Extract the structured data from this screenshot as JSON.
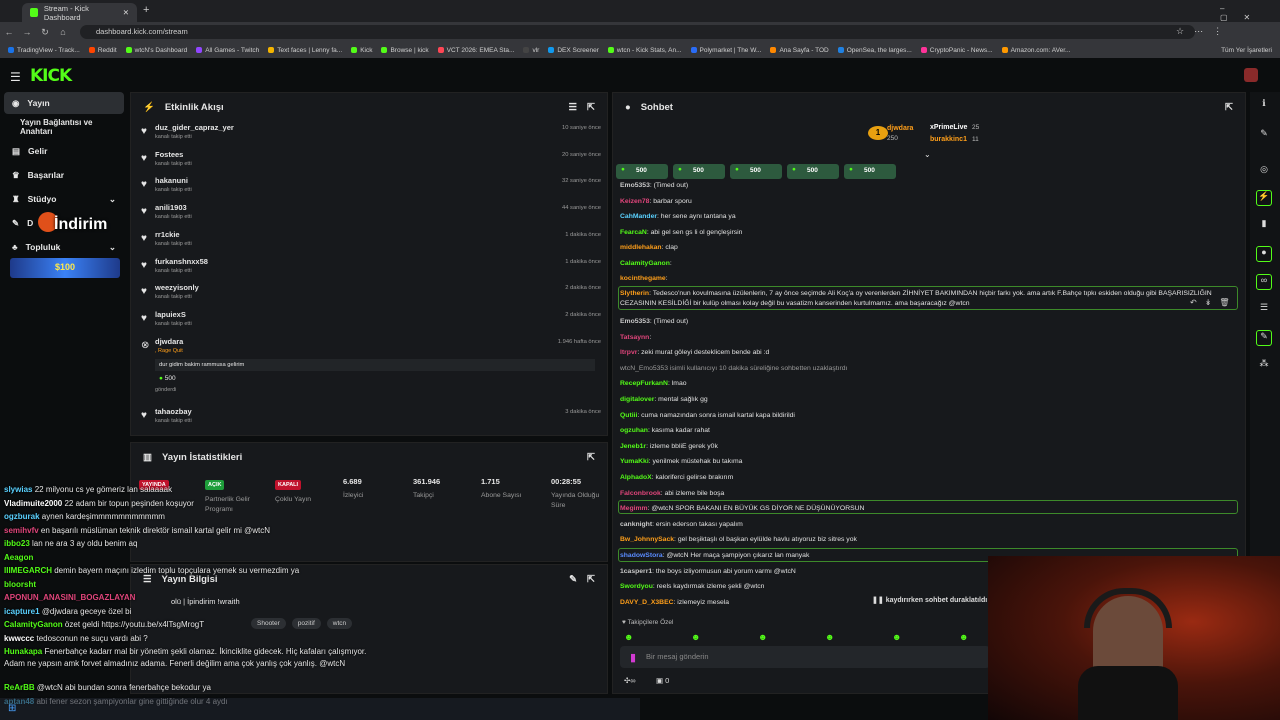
{
  "browser": {
    "tabs": [
      {
        "title": "Stream - Kick Dashboard"
      }
    ],
    "url": "dashboard.kick.com/stream",
    "bookmarks": [
      "TradingView - Track...",
      "Reddit",
      "wtcN's Dashboard",
      "All Games - Twitch",
      "Text faces | Lenny fa...",
      "Kick",
      "Browse | kick",
      "VCT 2026: EMEA Sta...",
      "vlr",
      "DEX Screener",
      "wtcn - Kick Stats, An...",
      "Polymarket | The W...",
      "Ana Sayfa - TOD",
      "OpenSea, the larges...",
      "CryptoPanic - News...",
      "Amazon.com: AVer..."
    ],
    "all_bookmarks": "Tüm Yer İşaretleri"
  },
  "sidebar": {
    "items": [
      {
        "label": "Yayın",
        "icon": "broadcast-icon"
      },
      {
        "label": "Yayın Bağlantısı ve Anahtarı",
        "icon": ""
      },
      {
        "label": "Gelir",
        "icon": "money-icon"
      },
      {
        "label": "Başarılar",
        "icon": "trophy-icon"
      },
      {
        "label": "Stüdyo",
        "icon": "studio-icon"
      },
      {
        "label": "D",
        "icon": "tool-icon"
      },
      {
        "label": "Topluluk",
        "icon": "people-icon"
      }
    ],
    "overlay_text": "İndirim",
    "promo": "$100"
  },
  "activity": {
    "title": "Etkinlik Akışı",
    "items": [
      {
        "name": "duz_gider_capraz_yer",
        "sub": "kanalı takip etti",
        "time": "10 saniye önce"
      },
      {
        "name": "Fostees",
        "sub": "kanalı takip etti",
        "time": "20 saniye önce"
      },
      {
        "name": "hakanuni",
        "sub": "kanalı takip etti",
        "time": "32 saniye önce"
      },
      {
        "name": "anili1903",
        "sub": "kanalı takip etti",
        "time": "44 saniye önce"
      },
      {
        "name": "rr1ckie",
        "sub": "kanalı takip etti",
        "time": "1 dakika önce"
      },
      {
        "name": "furkanshnxx58",
        "sub": "kanalı takip etti",
        "time": "1 dakika önce"
      },
      {
        "name": "weezyisonly",
        "sub": "kanalı takip etti",
        "time": "2 dakika önce"
      },
      {
        "name": "lapuiexS",
        "sub": "kanalı takip etti",
        "time": "2 dakika önce"
      },
      {
        "name": "djwdara",
        "sub": ", Rage Quit",
        "time": "1.946 hafta önce",
        "message": "dur gidim bakim rammusa gelirim",
        "amount": "500",
        "sent": "gönderdi"
      },
      {
        "name": "tahaozbay",
        "sub": "kanalı takip etti",
        "time": "3 dakika önce"
      }
    ]
  },
  "stats": {
    "title": "Yayın İstatistikleri",
    "items": [
      {
        "badge": "YAYINDA",
        "label": ""
      },
      {
        "badge": "AÇIK",
        "label": "Partnerlik Gelir Programı"
      },
      {
        "badge": "KAPALI",
        "label": "Çoklu Yayın"
      },
      {
        "value": "6.689",
        "label": "İzleyici"
      },
      {
        "value": "361.946",
        "label": "Takipçi"
      },
      {
        "value": "1.715",
        "label": "Abone Sayısı"
      },
      {
        "value": "00:28:55",
        "label": "Yayında Olduğu Süre"
      }
    ]
  },
  "stream_info": {
    "title": "Yayın Bilgisi",
    "line1": "olü | İpindirim !wraith",
    "tags": [
      "Shooter",
      "pozitif",
      "wtcn"
    ]
  },
  "chat": {
    "title": "Sohbet",
    "leaderboard": [
      {
        "rank": "1",
        "name": "djwdara",
        "value": "250"
      },
      {
        "rank": "",
        "name": "xPrimeLive",
        "value": "25"
      },
      {
        "rank": "",
        "name": "burakkinc1",
        "value": "11"
      }
    ],
    "gifts": [
      "500",
      "500",
      "500",
      "500",
      "500"
    ],
    "messages": [
      {
        "user": "Emo5353",
        "text": "(Timed out)",
        "color": "#c9c9c9"
      },
      {
        "user": "Keizen78",
        "text": "barbar sporu",
        "color": "#e0457b"
      },
      {
        "user": "CahMander",
        "text": "her sene aynı tantana ya",
        "color": "#5ad1ff"
      },
      {
        "user": "FearcaN",
        "text": "abi gel sen gs li ol gençleşirsin",
        "color": "#53fc18"
      },
      {
        "user": "middlehakan",
        "text": "clap",
        "color": "#ff9f1a"
      },
      {
        "user": "CalamityGanon",
        "text": "",
        "color": "#53fc18"
      },
      {
        "user": "kocinthegame",
        "text": "",
        "color": "#ff9f1a"
      },
      {
        "user": "Slytherin",
        "text": "Tedesco'nun kovulmasına üzülenlerin, 7 ay önce seçimde Ali Koç'a oy verenlerden ZİHNİYET BAKIMINDAN hiçbir farkı yok. ama artık F.Bahçe tıpkı eskiden olduğu gibi BAŞARISIZLIĞIN CEZASININ KESİLDİĞİ bir kulüp olması kolay değil bu vasatizm kanserinden kurtulmamız. ama başaracağız @wtcn",
        "color": "#ff9f1a"
      },
      {
        "user": "Emo5353",
        "text": "(Timed out)",
        "color": "#c9c9c9"
      },
      {
        "user": "Tatsaynn",
        "text": "",
        "color": "#e0457b"
      },
      {
        "user": "ltrpvr",
        "text": "zeki murat göleyi desteklicem bende abi :d",
        "color": "#e0457b"
      },
      {
        "user": "",
        "text": "wtcN_Emo5353 isimli kullanıcıyı 10 dakika süreliğine sohbetten uzaklaştırdı",
        "color": "#9a9a9a"
      },
      {
        "user": "RecepFurkanN",
        "text": "lmao",
        "color": "#53fc18"
      },
      {
        "user": "digitalover",
        "text": "mental sağlık gg",
        "color": "#53fc18"
      },
      {
        "user": "Qutiii",
        "text": "cuma namazından sonra ismail kartal kapa bildirildi",
        "color": "#53fc18"
      },
      {
        "user": "ogzuhan",
        "text": "kasıma kadar rahat",
        "color": "#53fc18"
      },
      {
        "user": "Jeneb1r",
        "text": "izleme bbliE gerek y0k",
        "color": "#53fc18"
      },
      {
        "user": "YumaKki",
        "text": "yenilmek müstehak bu takıma",
        "color": "#53fc18"
      },
      {
        "user": "AlphadoX",
        "text": "kaloriferci gelirse brakırım",
        "color": "#53fc18"
      },
      {
        "user": "Falconbrook",
        "text": "abi izleme bile boşa",
        "color": "#e0457b"
      },
      {
        "user": "Megimm",
        "text": "@wtcN SPOR BAKANI EN BÜYÜK GS DİYOR NE DÜŞÜNÜYORSUN",
        "color": "#e0457b"
      },
      {
        "user": "canknight",
        "text": "ersin ederson takası yapalım",
        "color": "#c9c9c9"
      },
      {
        "user": "Bw_JohnnySack",
        "text": "gel beşiktaşlı ol başkan eylülde havlu atıyoruz biz sitres yok",
        "color": "#ff9f1a"
      },
      {
        "user": "shadowStora",
        "text": "@wtcN Her maça şampiyon çıkarız lan manyak",
        "color": "#5a8cff"
      },
      {
        "user": "1casperr1",
        "text": "the boys izliyormusun abi yorum varmı @wtcN",
        "color": "#c9c9c9"
      },
      {
        "user": "Swordyou",
        "text": "reels kaydırmak izleme şekli @wtcn",
        "color": "#53fc18"
      },
      {
        "user": "DAVY_D_X3BEC",
        "text": "izlemeyiz mesela",
        "color": "#ff9f1a"
      }
    ],
    "paused": "kaydırırken sohbet duraklatıldı",
    "follower_only": "Takipçilere Özel",
    "input_placeholder": "Bir mesaj gönderin",
    "footer_count": "0"
  },
  "overlay_chat": [
    {
      "user": "slywias",
      "text": "22 milyonu cs ye gömeriz lan salaaaak",
      "color": "#5ad1ff"
    },
    {
      "user": "Vladimuite2000",
      "text": "22 adam bir topun peşinden koşuyor",
      "color": "#ffffff"
    },
    {
      "user": "ogzburak",
      "text": "aynen kardeşimmmmmmmmmmm",
      "color": "#5ad1ff"
    },
    {
      "user": "semihvfv",
      "text": "en başarılı müslüman teknik direktör ismail kartal gelir mi @wtcN",
      "color": "#e0457b"
    },
    {
      "user": "ibbo23",
      "text": "lan ne ara 3 ay oldu benim aq",
      "color": "#53fc18"
    },
    {
      "user": "Aeagon",
      "text": "",
      "color": "#53fc18"
    },
    {
      "user": "IIIMEGARCH",
      "text": "demin bayern maçını izledim toplu topçulara yemek su vermezdim ya",
      "color": "#53fc18"
    },
    {
      "user": "bloorsht",
      "text": "",
      "color": "#53fc18"
    },
    {
      "user": "APONUN_ANASINI_BOGAZLAYAN",
      "text": "",
      "color": "#e0457b"
    },
    {
      "user": "icapture1",
      "text": "@djwdara geceye özel bi",
      "color": "#5ad1ff"
    },
    {
      "user": "CalamityGanon",
      "text": "özet geldi https://youtu.be/x4lTsgMrogT",
      "color": "#53fc18"
    },
    {
      "user": "kwwccc",
      "text": "tedosconun ne suçu vardı abi ?",
      "color": "#ffffff"
    },
    {
      "user": "Hunakapa",
      "text": "Fenerbahçe kadarr mal bir yönetim şekli olamaz. İkinciklite gidecek. Hiç kafaları çalışmıyor. Adam ne yapsın amk forvet almadınız adama. Fenerli değilim ama çok yanlış çok yanlış. @wtcN",
      "color": "#53fc18"
    },
    {
      "user": "ReArBB",
      "text": "@wtcN abi bundan sonra fenerbahçe bekodur ya",
      "color": "#53fc18"
    },
    {
      "user": "aptan48",
      "text": "abi fener sezon şampiyonlar gine gittiğinde olur 4 aydı",
      "color": "#5ad1ff"
    }
  ],
  "colors": {
    "accent": "#53fc18",
    "panel": "#17191c",
    "bg": "#0b0d0e"
  }
}
